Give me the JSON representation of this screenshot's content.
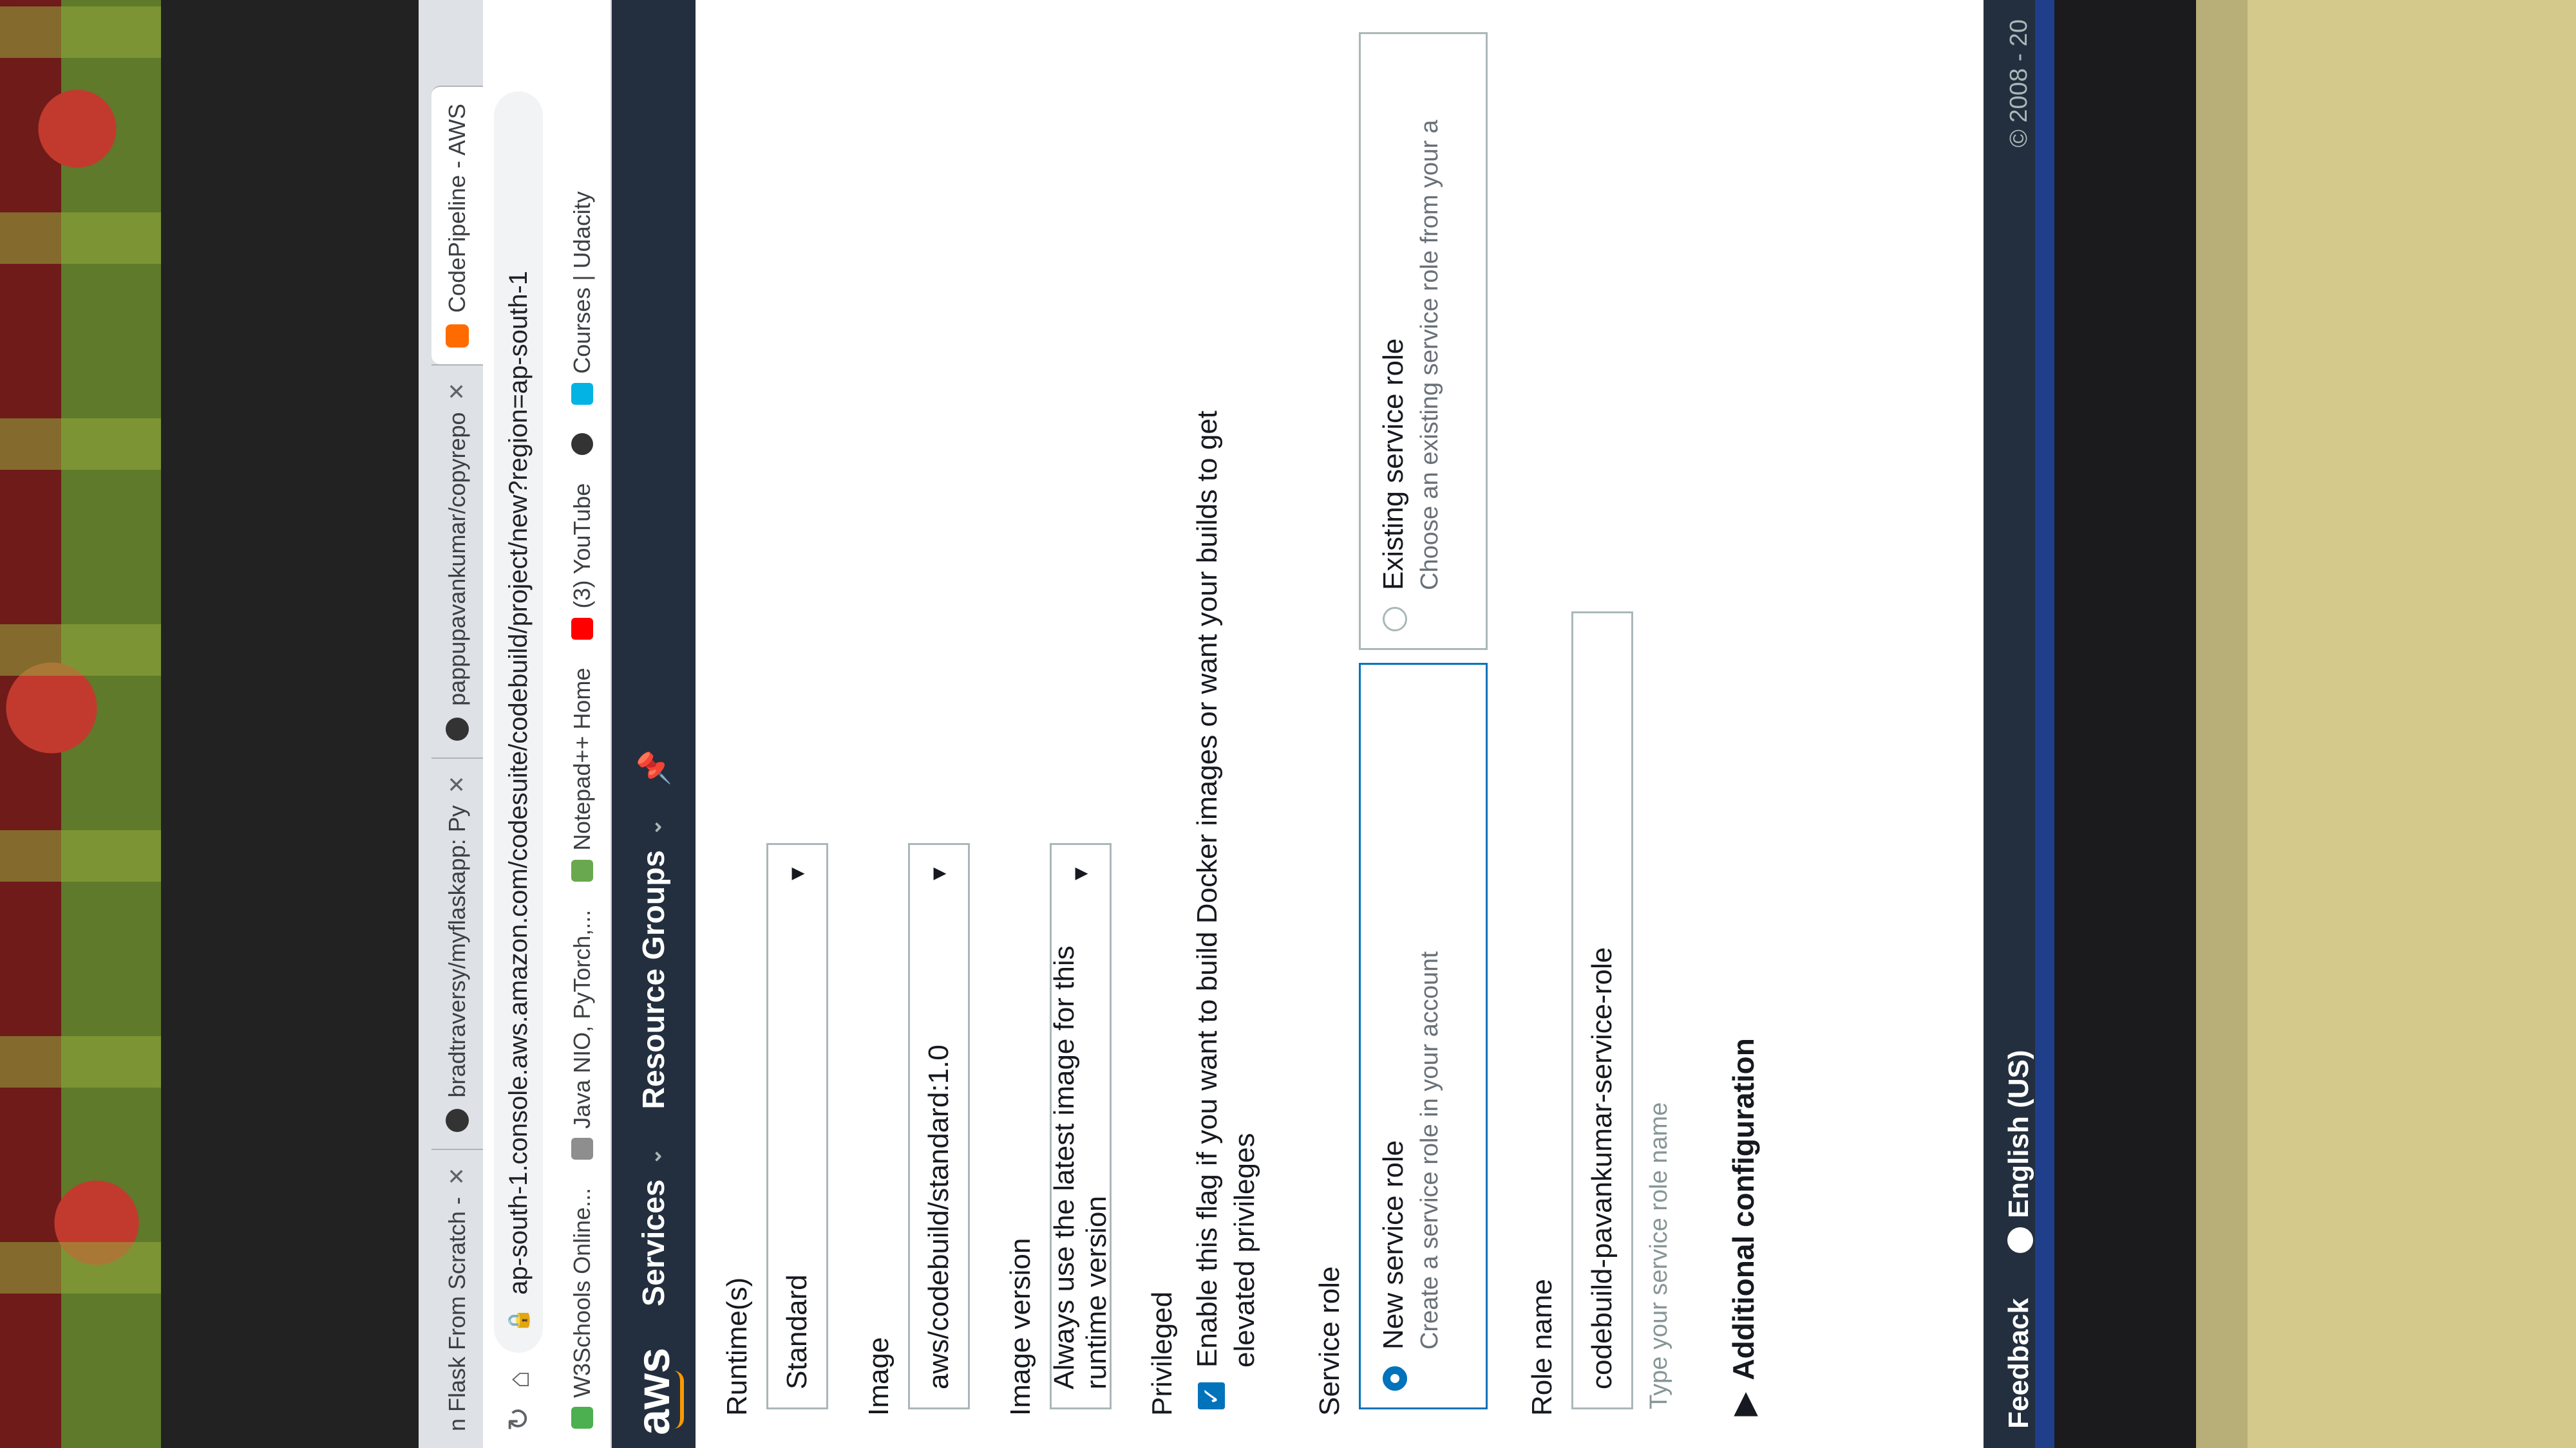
{
  "browser": {
    "tabs": [
      {
        "label": "n Flask From Scratch -",
        "active": false
      },
      {
        "label": "bradtraversy/myflaskapp: Py",
        "active": false
      },
      {
        "label": "pappupavankumar/copyrepo",
        "active": false
      },
      {
        "label": "CodePipeline - AWS",
        "active": true
      }
    ],
    "url": "ap-south-1.console.aws.amazon.com/codesuite/codebuild/project/new?region=ap-south-1",
    "bookmarks": [
      {
        "label": "W3Schools Online...",
        "color": "#4caf50"
      },
      {
        "label": "Java NIO, PyTorch,...",
        "color": "#8e8e8e"
      },
      {
        "label": "Notepad++ Home",
        "color": "#6aa84f"
      },
      {
        "label": "(3) YouTube",
        "color": "#ff0000"
      },
      {
        "label": "",
        "color": "#333333"
      },
      {
        "label": "Courses | Udacity",
        "color": "#02b3e4"
      }
    ]
  },
  "aws_header": {
    "logo": "aws",
    "services": "Services",
    "resource_groups": "Resource Groups"
  },
  "form": {
    "runtime_label": "Runtime(s)",
    "runtime_value": "Standard",
    "image_label": "Image",
    "image_value": "aws/codebuild/standard:1.0",
    "image_version_label": "Image version",
    "image_version_value": "Always use the latest image for this runtime version",
    "privileged_label": "Privileged",
    "privileged_checked": true,
    "privileged_text_1": "Enable this flag if you want to build Docker images or want your builds to get",
    "privileged_text_2": "elevated privileges",
    "service_role_label": "Service role",
    "new_role_title": "New service role",
    "new_role_desc": "Create a service role in your account",
    "existing_role_title": "Existing service role",
    "existing_role_desc": "Choose an existing service role from your a",
    "role_name_label": "Role name",
    "role_name_value": "codebuild-pavankumar-service-role",
    "role_name_hint": "Type your service role name",
    "additional_config": "Additional configuration"
  },
  "footer": {
    "feedback": "Feedback",
    "language": "English (US)",
    "copyright": "© 2008 - 20"
  },
  "colors": {
    "aws_navy": "#232f3e",
    "aws_orange": "#ff9900",
    "selected_blue": "#0073bb"
  }
}
